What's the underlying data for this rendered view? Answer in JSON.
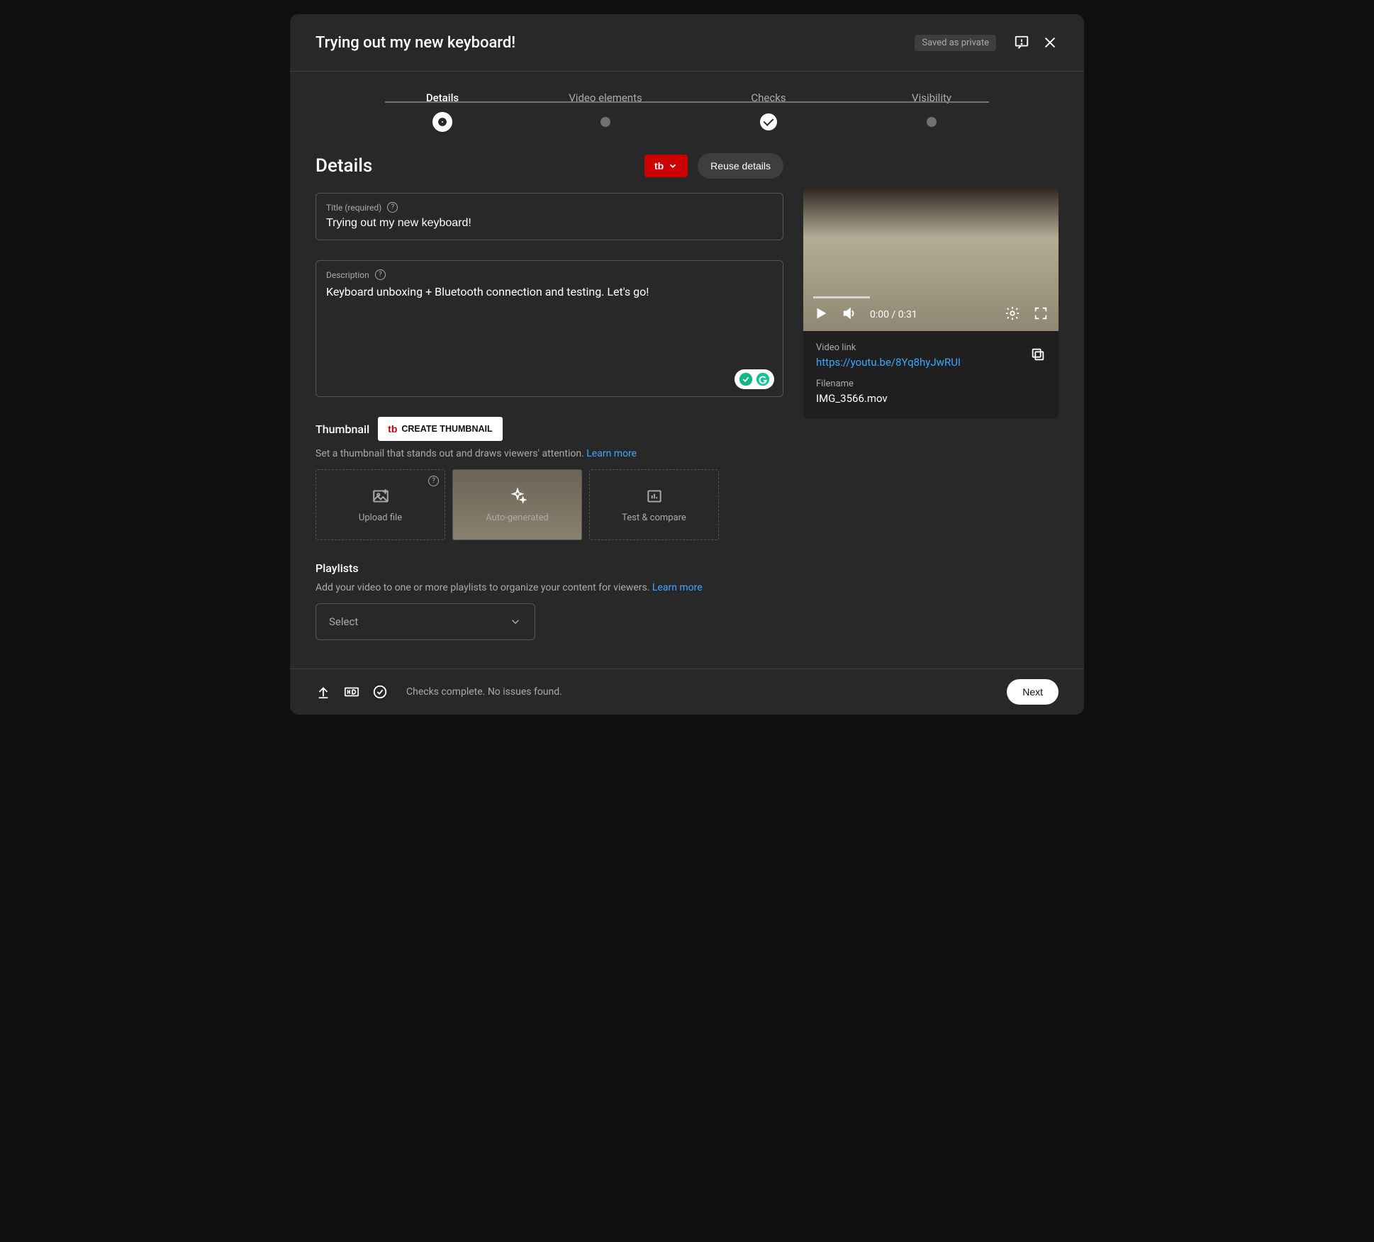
{
  "header": {
    "title": "Trying out my new keyboard!",
    "save_status": "Saved as private"
  },
  "stepper": {
    "steps": [
      "Details",
      "Video elements",
      "Checks",
      "Visibility"
    ]
  },
  "details": {
    "heading": "Details",
    "reuse_label": "Reuse details",
    "title_field_label": "Title (required)",
    "title_value": "Trying out my new keyboard!",
    "desc_field_label": "Description",
    "desc_value": "Keyboard unboxing + Bluetooth connection and testing. Let's go!"
  },
  "thumbnail": {
    "heading": "Thumbnail",
    "create_label": "CREATE THUMBNAIL",
    "description": "Set a thumbnail that stands out and draws viewers' attention. ",
    "learn_more": "Learn more",
    "options": [
      "Upload file",
      "Auto-generated",
      "Test & compare"
    ]
  },
  "playlists": {
    "heading": "Playlists",
    "description": "Add your video to one or more playlists to organize your content for viewers. ",
    "learn_more": "Learn more",
    "select_label": "Select"
  },
  "preview": {
    "time": "0:00 / 0:31",
    "video_link_label": "Video link",
    "video_link": "https://youtu.be/8Yq8hyJwRUI",
    "filename_label": "Filename",
    "filename": "IMG_3566.mov"
  },
  "footer": {
    "status": "Checks complete. No issues found.",
    "next_label": "Next"
  }
}
